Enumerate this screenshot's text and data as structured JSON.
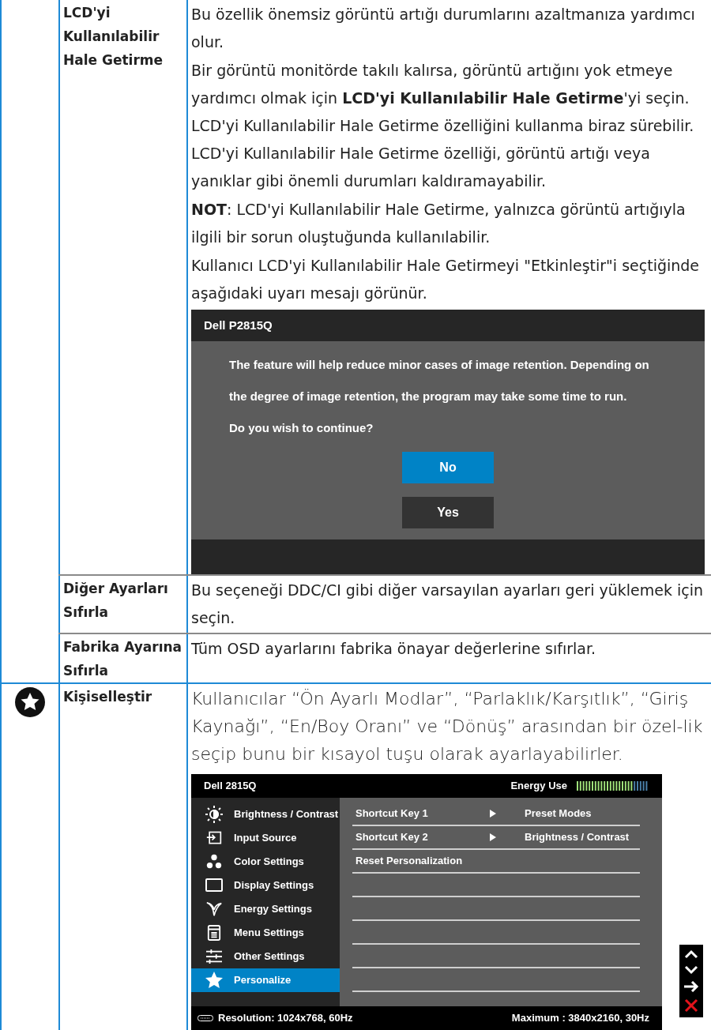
{
  "sections": [
    {
      "has_icon": false,
      "rows": [
        {
          "label": "LCD'yi Kullanılabilir Hale Getirme",
          "content": [
            {
              "kind": "paragraph",
              "text": "Bu özellik önemsiz görüntü artığı durumlarını azaltmanıza yardımcı olur."
            },
            {
              "kind": "paragraph",
              "text": "Bir görüntü monitörde takılı kalırsa, görüntü artığını yok etmeye yardımcı olmak için **LCD'yi Kullanılabilir Hale Getirme**'yi seçin. LCD'yi Kullanılabilir Hale Getirme özelliğini kullanma biraz sürebilir. LCD'yi Kullanılabilir Hale Getirme özelliği, görüntü artığı veya yanıklar gibi önemli durumları kaldıramayabilir."
            },
            {
              "kind": "paragraph",
              "text": "**NOT**: LCD'yi Kullanılabilir Hale Getirme, yalnızca görüntü artığıyla ilgili bir sorun oluştuğunda kullanılabilir."
            },
            {
              "kind": "paragraph",
              "text": "Kullanıcı LCD'yi Kullanılabilir Hale Getirmeyi \"Etkinleştir\"i seçtiğinde aşağıdaki uyarı mesajı görünür."
            },
            {
              "kind": "dialog",
              "title": "Dell P2815Q",
              "lines": [
                "The feature will help reduce minor cases of image retention. Depending on",
                "the degree of image retention, the program may take some time to run.",
                "Do you wish to continue?"
              ],
              "buttons": [
                {
                  "label": "No",
                  "selected": true
                },
                {
                  "label": "Yes",
                  "selected": false
                }
              ]
            }
          ]
        },
        {
          "label": "Diğer Ayarları Sıfırla",
          "content": [
            {
              "kind": "paragraph",
              "text": "Bu seçeneği DDC/CI gibi diğer varsayılan ayarları geri yüklemek için seçin."
            }
          ]
        },
        {
          "label": "Fabrika Ayarına Sıfırla",
          "content": [
            {
              "kind": "paragraph",
              "text": "Tüm OSD ayarlarını fabrika önayar değerlerine sıfırlar."
            }
          ]
        }
      ]
    },
    {
      "has_icon": true,
      "rows": [
        {
          "label": "Kişiselleştir",
          "content": [
            {
              "kind": "lead",
              "text": "Kullanıcılar “Ön Ayarlı Modlar”, “Parlaklık/Karşıtlık”, “Giriş Kaynağı”, “En/Boy Oranı” ve “Dönüş” arasından bir özel-lik seçip bunu bir kısayol tuşu olarak ayarlayabilirler."
            },
            {
              "kind": "osd",
              "title": "Dell 2815Q",
              "energy_label": "Energy Use",
              "energy": {
                "level": 0.8
              },
              "menu": [
                {
                  "label": "Brightness / Contrast",
                  "selected": false
                },
                {
                  "label": "Input Source",
                  "selected": false
                },
                {
                  "label": "Color Settings",
                  "selected": false
                },
                {
                  "label": "Display Settings",
                  "selected": false
                },
                {
                  "label": "Energy Settings",
                  "selected": false
                },
                {
                  "label": "Menu Settings",
                  "selected": false
                },
                {
                  "label": "Other Settings",
                  "selected": false
                },
                {
                  "label": "Personalize",
                  "selected": true
                }
              ],
              "options": [
                {
                  "label": "Shortcut Key 1",
                  "value": "Preset Modes"
                },
                {
                  "label": "Shortcut Key 2",
                  "value": "Brightness / Contrast"
                },
                {
                  "label": "Reset Personalization"
                }
              ],
              "resolution": "Resolution: 1024x768,  60Hz",
              "maximum": "Maximum : 3840x2160,  30Hz"
            }
          ]
        }
      ]
    }
  ]
}
